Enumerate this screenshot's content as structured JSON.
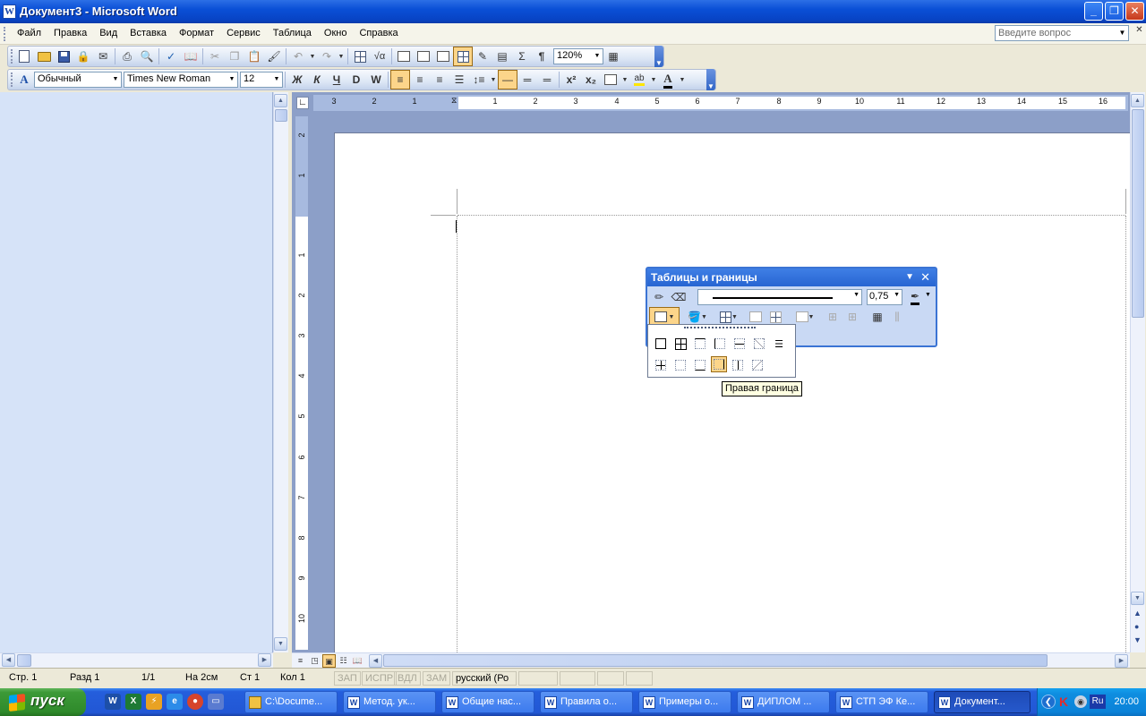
{
  "window": {
    "title": "Документ3 - Microsoft Word",
    "app_icon": "W",
    "minimize": "_",
    "maximize": "❐",
    "close": "✕"
  },
  "menu": [
    "Файл",
    "Правка",
    "Вид",
    "Вставка",
    "Формат",
    "Сервис",
    "Таблица",
    "Окно",
    "Справка"
  ],
  "help_search": {
    "placeholder": "Введите вопрос"
  },
  "standard_toolbar": {
    "zoom": "120%"
  },
  "formatting_toolbar": {
    "style": "Обычный",
    "font": "Times New Roman",
    "size": "12",
    "bold": "Ж",
    "italic": "К",
    "underline": "Ч"
  },
  "ruler": {
    "h_ticks": [
      "3",
      "2",
      "1",
      "1",
      "2",
      "3",
      "4",
      "5",
      "6",
      "7",
      "8",
      "9",
      "10",
      "11",
      "12",
      "13",
      "14",
      "15",
      "16"
    ],
    "v_ticks": [
      "2",
      "1",
      "1",
      "2",
      "3",
      "4",
      "5",
      "6",
      "7",
      "8",
      "9",
      "10"
    ]
  },
  "tables_toolbar": {
    "title": "Таблицы и границы",
    "line_weight": "0,75"
  },
  "tooltip": "Правая граница",
  "status": {
    "page": "Стр. 1",
    "section": "Разд 1",
    "pages": "1/1",
    "at": "На 2см",
    "line": "Ст 1",
    "col": "Кол 1",
    "rec": "ЗАП",
    "trk": "ИСПР",
    "ext": "ВДЛ",
    "ovr": "ЗАМ",
    "lang": "русский (Ро"
  },
  "taskbar": {
    "start": "пуск",
    "tasks": [
      "C:\\Docume...",
      "Метод. ук...",
      "Общие нас...",
      "Правила о...",
      "Примеры о...",
      "ДИПЛОМ ...",
      "СТП ЭФ Ке...",
      "Документ..."
    ],
    "tray_lang": "Ru",
    "clock": "20:00"
  },
  "colors": {
    "title_blue": "#0a4fd6",
    "taskbar_blue": "#245edc",
    "start_green": "#3c9a37",
    "highlight": "#fcd58a"
  }
}
